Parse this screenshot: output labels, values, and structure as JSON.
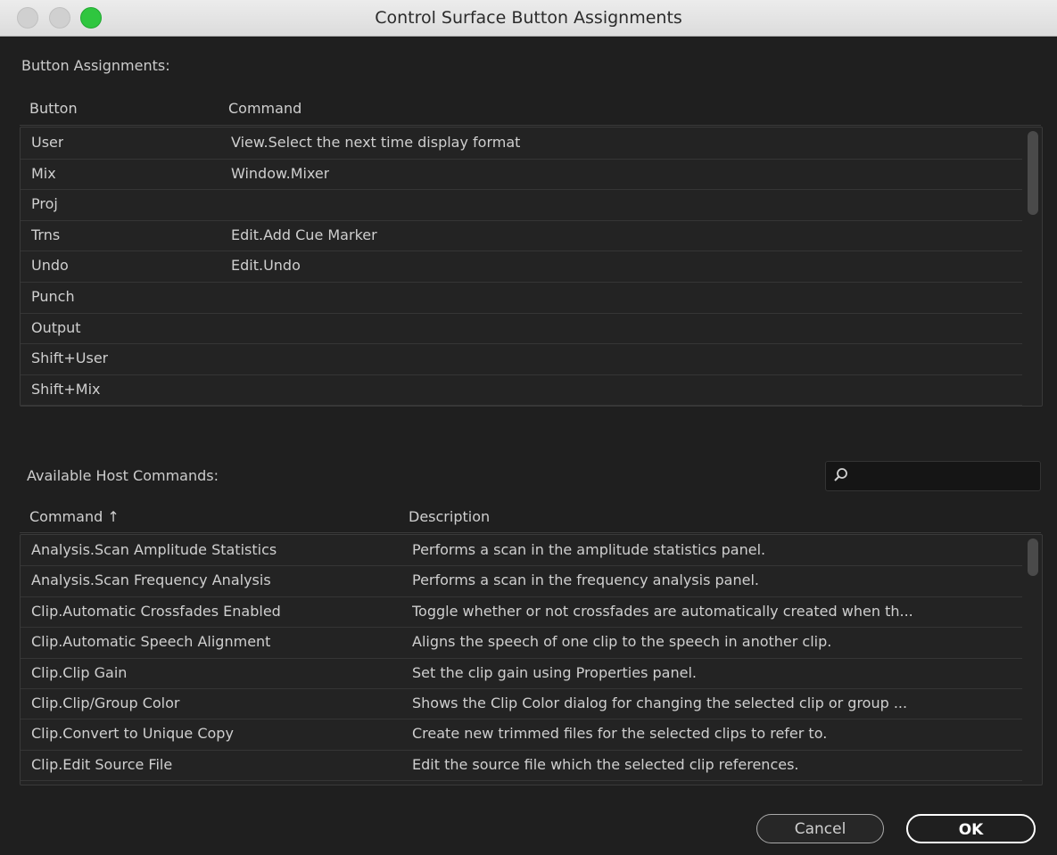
{
  "window": {
    "title": "Control Surface Button Assignments"
  },
  "assignments": {
    "label": "Button Assignments:",
    "headers": {
      "button": "Button",
      "command": "Command"
    },
    "rows": [
      {
        "button": "User",
        "command": "View.Select the next time display format"
      },
      {
        "button": "Mix",
        "command": "Window.Mixer"
      },
      {
        "button": "Proj",
        "command": ""
      },
      {
        "button": "Trns",
        "command": "Edit.Add Cue Marker"
      },
      {
        "button": "Undo",
        "command": "Edit.Undo"
      },
      {
        "button": "Punch",
        "command": ""
      },
      {
        "button": "Output",
        "command": ""
      },
      {
        "button": "Shift+User",
        "command": ""
      },
      {
        "button": "Shift+Mix",
        "command": ""
      }
    ]
  },
  "host_commands": {
    "label": "Available Host Commands:",
    "search": {
      "value": "",
      "placeholder": ""
    },
    "headers": {
      "command": "Command ↑",
      "description": "Description"
    },
    "rows": [
      {
        "command": "Analysis.Scan Amplitude Statistics",
        "description": "Performs a scan in the amplitude statistics panel."
      },
      {
        "command": "Analysis.Scan Frequency Analysis",
        "description": "Performs a scan in the frequency analysis panel."
      },
      {
        "command": "Clip.Automatic Crossfades Enabled",
        "description": "Toggle whether or not crossfades are automatically created when th..."
      },
      {
        "command": "Clip.Automatic Speech Alignment",
        "description": "Aligns the speech of one clip to the speech in another clip."
      },
      {
        "command": "Clip.Clip Gain",
        "description": "Set the clip gain using Properties panel."
      },
      {
        "command": "Clip.Clip/Group Color",
        "description": "Shows the Clip Color dialog for changing the selected clip or group ..."
      },
      {
        "command": "Clip.Convert to Unique Copy",
        "description": "Create new trimmed files for the selected clips to refer to."
      },
      {
        "command": "Clip.Edit Source File",
        "description": "Edit the source file which the selected clip references."
      }
    ]
  },
  "buttons": {
    "cancel": "Cancel",
    "ok": "OK"
  },
  "colors": {
    "background": "#1f1f1f",
    "maximize": "#2fc63f",
    "text": "#cfcfcf"
  }
}
